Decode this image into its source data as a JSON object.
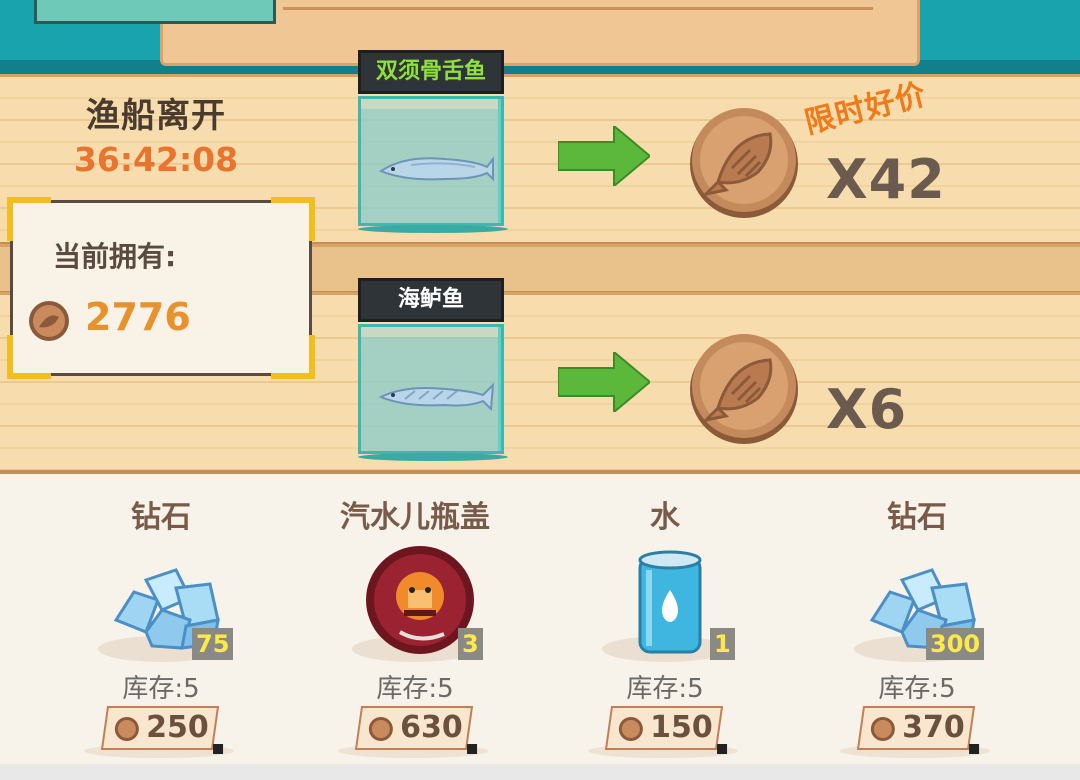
{
  "boat": {
    "title": "渔船离开",
    "timer": "36:42:08"
  },
  "owned": {
    "label": "当前拥有:",
    "value": "2776"
  },
  "trades": [
    {
      "fish": "双须骨舌鱼",
      "multiplier": "X42",
      "promo": "限时好价"
    },
    {
      "fish": "海鲈鱼",
      "multiplier": "X6"
    }
  ],
  "shop": {
    "items": [
      {
        "name": "钻石",
        "count": "75",
        "stock": "库存:5",
        "price": "250",
        "icon": "diamond-icon"
      },
      {
        "name": "汽水儿瓶盖",
        "count": "3",
        "stock": "库存:5",
        "price": "630",
        "icon": "bottle-cap-icon"
      },
      {
        "name": "水",
        "count": "1",
        "stock": "库存:5",
        "price": "150",
        "icon": "water-can-icon"
      },
      {
        "name": "钻石",
        "count": "300",
        "stock": "库存:5",
        "price": "370",
        "icon": "diamond-icon"
      }
    ]
  },
  "colors": {
    "accent": "#e8742e",
    "frame": "#f2be1f",
    "arrow": "#5bb83a",
    "coin": "#b8794f"
  }
}
